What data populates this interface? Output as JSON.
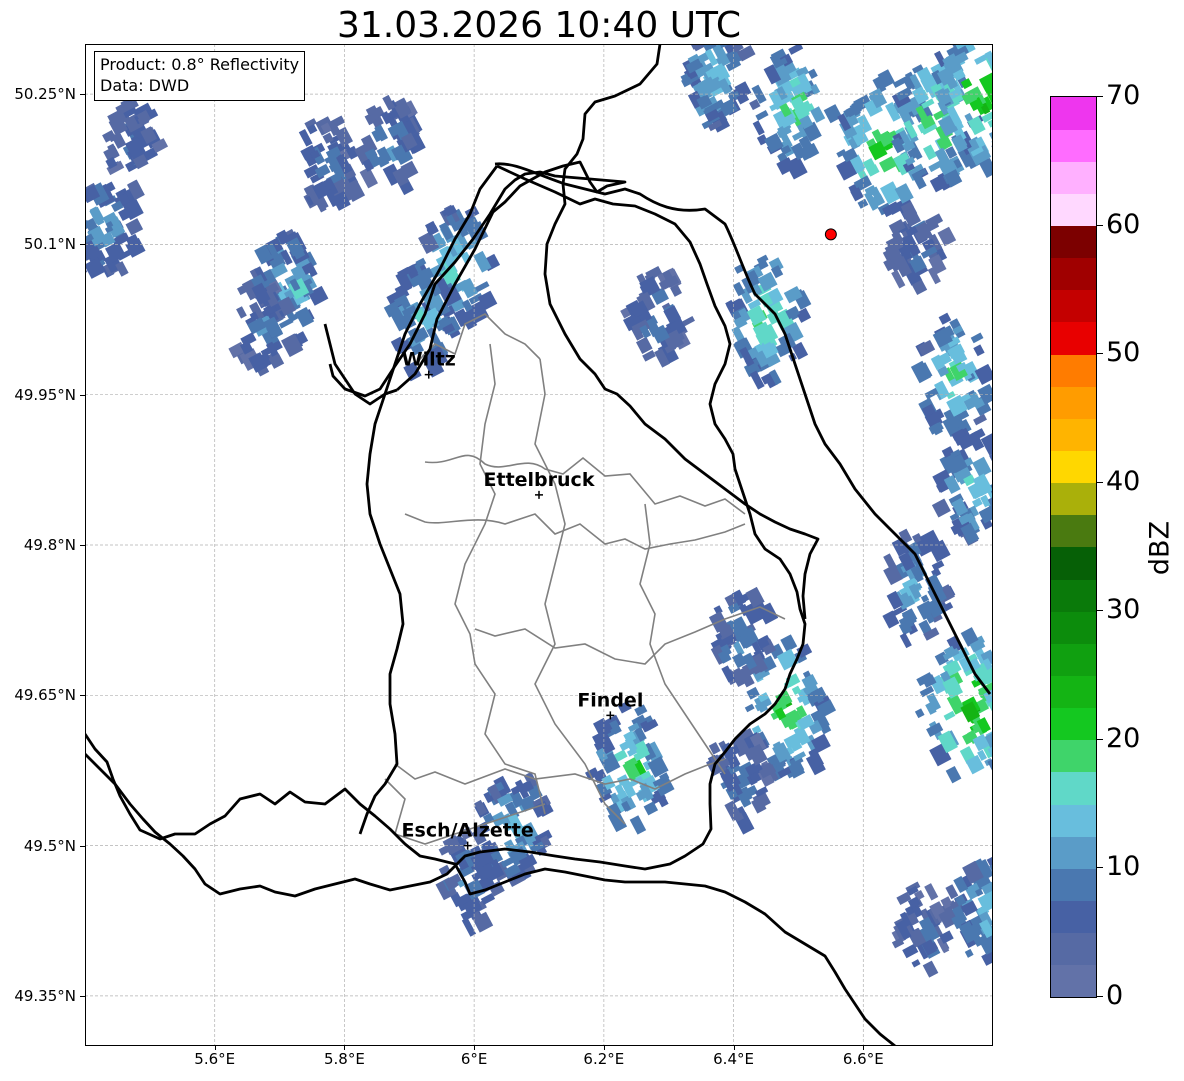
{
  "title": "31.03.2026 10:40 UTC",
  "info": {
    "product": "Product: 0.8° Reflectivity",
    "data_source": "Data: DWD"
  },
  "axes": {
    "lat_ticks": [
      {
        "value": 50.25,
        "label": "50.25°N"
      },
      {
        "value": 50.1,
        "label": "50.1°N"
      },
      {
        "value": 49.95,
        "label": "49.95°N"
      },
      {
        "value": 49.8,
        "label": "49.8°N"
      },
      {
        "value": 49.65,
        "label": "49.65°N"
      },
      {
        "value": 49.5,
        "label": "49.5°N"
      },
      {
        "value": 49.35,
        "label": "49.35°N"
      }
    ],
    "lon_ticks": [
      {
        "value": 5.6,
        "label": "5.6°E"
      },
      {
        "value": 5.8,
        "label": "5.8°E"
      },
      {
        "value": 6.0,
        "label": "6°E"
      },
      {
        "value": 6.2,
        "label": "6.2°E"
      },
      {
        "value": 6.4,
        "label": "6.4°E"
      },
      {
        "value": 6.6,
        "label": "6.6°E"
      }
    ],
    "lon_range": [
      5.4,
      6.8
    ],
    "lat_range": [
      49.3,
      50.3
    ],
    "grid": true
  },
  "cities": [
    {
      "name": "Wiltz",
      "lon": 5.93,
      "lat": 49.97
    },
    {
      "name": "Ettelbruck",
      "lon": 6.1,
      "lat": 49.85
    },
    {
      "name": "Findel",
      "lon": 6.21,
      "lat": 49.63
    },
    {
      "name": "Esch/Alzette",
      "lon": 5.99,
      "lat": 49.5
    }
  ],
  "radar_site": {
    "lon": 6.55,
    "lat": 50.11,
    "color": "#ff0000"
  },
  "colorbar": {
    "title": "dBZ",
    "min": 0,
    "max": 70,
    "tick_labels": [
      "0",
      "10",
      "20",
      "30",
      "40",
      "50",
      "60",
      "70"
    ],
    "colors": [
      "#6272a8",
      "#566aa4",
      "#4761a4",
      "#4a78b0",
      "#5a9cc8",
      "#68bedd",
      "#60d8c8",
      "#3fd46a",
      "#14c820",
      "#14b414",
      "#10a010",
      "#0c8c0c",
      "#0a7a0a",
      "#066006",
      "#4a7a10",
      "#aab00a",
      "#ffd700",
      "#ffb400",
      "#ff9c00",
      "#ff7c00",
      "#e80000",
      "#c40000",
      "#a00000",
      "#7c0000",
      "#ffd8ff",
      "#ffb0ff",
      "#ff6cff",
      "#ee36ee"
    ]
  },
  "echoes": [
    {
      "lon": 5.42,
      "lat": 50.12,
      "dbz": 12
    },
    {
      "lon": 5.46,
      "lat": 50.2,
      "dbz": 8
    },
    {
      "lon": 5.7,
      "lat": 50.06,
      "dbz": 14
    },
    {
      "lon": 5.66,
      "lat": 50.02,
      "dbz": 9
    },
    {
      "lon": 5.76,
      "lat": 50.18,
      "dbz": 9
    },
    {
      "lon": 5.86,
      "lat": 50.2,
      "dbz": 10
    },
    {
      "lon": 5.96,
      "lat": 50.08,
      "dbz": 16
    },
    {
      "lon": 5.91,
      "lat": 50.03,
      "dbz": 14
    },
    {
      "lon": 6.36,
      "lat": 50.27,
      "dbz": 14
    },
    {
      "lon": 6.48,
      "lat": 50.24,
      "dbz": 17
    },
    {
      "lon": 6.62,
      "lat": 50.2,
      "dbz": 21
    },
    {
      "lon": 6.7,
      "lat": 50.23,
      "dbz": 20
    },
    {
      "lon": 6.77,
      "lat": 50.25,
      "dbz": 22
    },
    {
      "lon": 6.67,
      "lat": 50.1,
      "dbz": 8
    },
    {
      "lon": 6.44,
      "lat": 50.03,
      "dbz": 18
    },
    {
      "lon": 6.27,
      "lat": 50.03,
      "dbz": 9
    },
    {
      "lon": 6.73,
      "lat": 49.97,
      "dbz": 17
    },
    {
      "lon": 6.76,
      "lat": 49.86,
      "dbz": 15
    },
    {
      "lon": 6.67,
      "lat": 49.76,
      "dbz": 13
    },
    {
      "lon": 6.47,
      "lat": 49.64,
      "dbz": 20
    },
    {
      "lon": 6.4,
      "lat": 49.71,
      "dbz": 10
    },
    {
      "lon": 6.75,
      "lat": 49.64,
      "dbz": 23
    },
    {
      "lon": 6.23,
      "lat": 49.58,
      "dbz": 17
    },
    {
      "lon": 6.05,
      "lat": 49.52,
      "dbz": 14
    },
    {
      "lon": 5.98,
      "lat": 49.47,
      "dbz": 10
    },
    {
      "lon": 6.4,
      "lat": 49.57,
      "dbz": 9
    },
    {
      "lon": 6.68,
      "lat": 49.42,
      "dbz": 8
    },
    {
      "lon": 6.78,
      "lat": 49.44,
      "dbz": 14
    }
  ]
}
